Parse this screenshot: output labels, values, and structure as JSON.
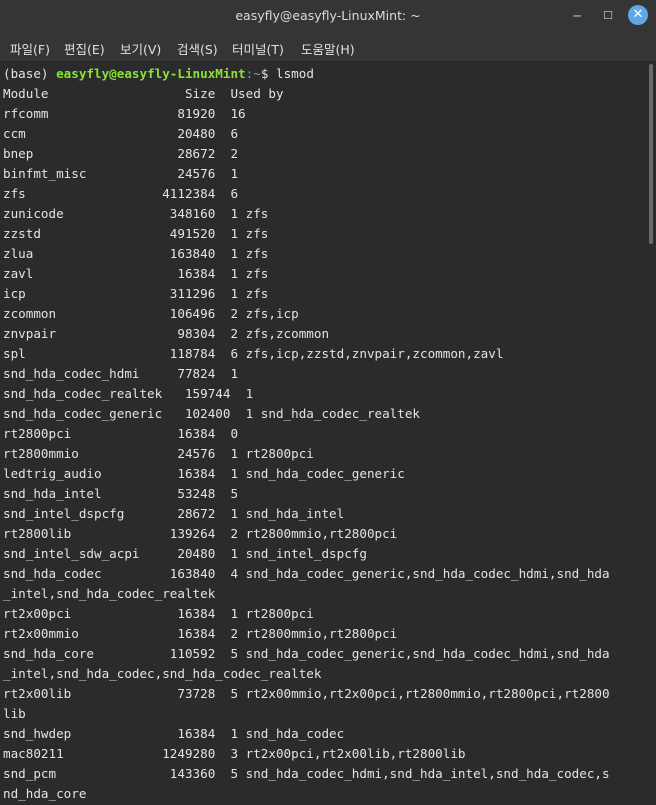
{
  "window": {
    "title": "easyfly@easyfly-LinuxMint: ~"
  },
  "window_controls": {
    "minimize": "─",
    "maximize": "☐",
    "close": "✕"
  },
  "menu": [
    "파일(F)",
    "편집(E)",
    "보기(V)",
    "검색(S)",
    "터미널(T)",
    "도움말(H)"
  ],
  "terminal": {
    "prompt": {
      "env": "(base) ",
      "user_host": "easyfly@easyfly-LinuxMint",
      "path": ":~",
      "symbol": "$ ",
      "command": "lsmod"
    },
    "lines": [
      "Module                  Size  Used by",
      "rfcomm                 81920  16",
      "ccm                    20480  6",
      "bnep                   28672  2",
      "binfmt_misc            24576  1",
      "zfs                  4112384  6",
      "zunicode              348160  1 zfs",
      "zzstd                 491520  1 zfs",
      "zlua                  163840  1 zfs",
      "zavl                   16384  1 zfs",
      "icp                   311296  1 zfs",
      "zcommon               106496  2 zfs,icp",
      "znvpair                98304  2 zfs,zcommon",
      "spl                   118784  6 zfs,icp,zzstd,znvpair,zcommon,zavl",
      "snd_hda_codec_hdmi     77824  1",
      "snd_hda_codec_realtek   159744  1",
      "snd_hda_codec_generic   102400  1 snd_hda_codec_realtek",
      "rt2800pci              16384  0",
      "rt2800mmio             24576  1 rt2800pci",
      "ledtrig_audio          16384  1 snd_hda_codec_generic",
      "snd_hda_intel          53248  5",
      "snd_intel_dspcfg       28672  1 snd_hda_intel",
      "rt2800lib             139264  2 rt2800mmio,rt2800pci",
      "snd_intel_sdw_acpi     20480  1 snd_intel_dspcfg",
      "snd_hda_codec         163840  4 snd_hda_codec_generic,snd_hda_codec_hdmi,snd_hda",
      "_intel,snd_hda_codec_realtek",
      "rt2x00pci              16384  1 rt2800pci",
      "rt2x00mmio             16384  2 rt2800mmio,rt2800pci",
      "snd_hda_core          110592  5 snd_hda_codec_generic,snd_hda_codec_hdmi,snd_hda",
      "_intel,snd_hda_codec,snd_hda_codec_realtek",
      "rt2x00lib              73728  5 rt2x00mmio,rt2x00pci,rt2800mmio,rt2800pci,rt2800",
      "lib",
      "snd_hwdep              16384  1 snd_hda_codec",
      "mac80211             1249280  3 rt2x00pci,rt2x00lib,rt2800lib",
      "snd_pcm               143360  5 snd_hda_codec_hdmi,snd_hda_intel,snd_hda_codec,s",
      "nd_hda_core"
    ]
  }
}
